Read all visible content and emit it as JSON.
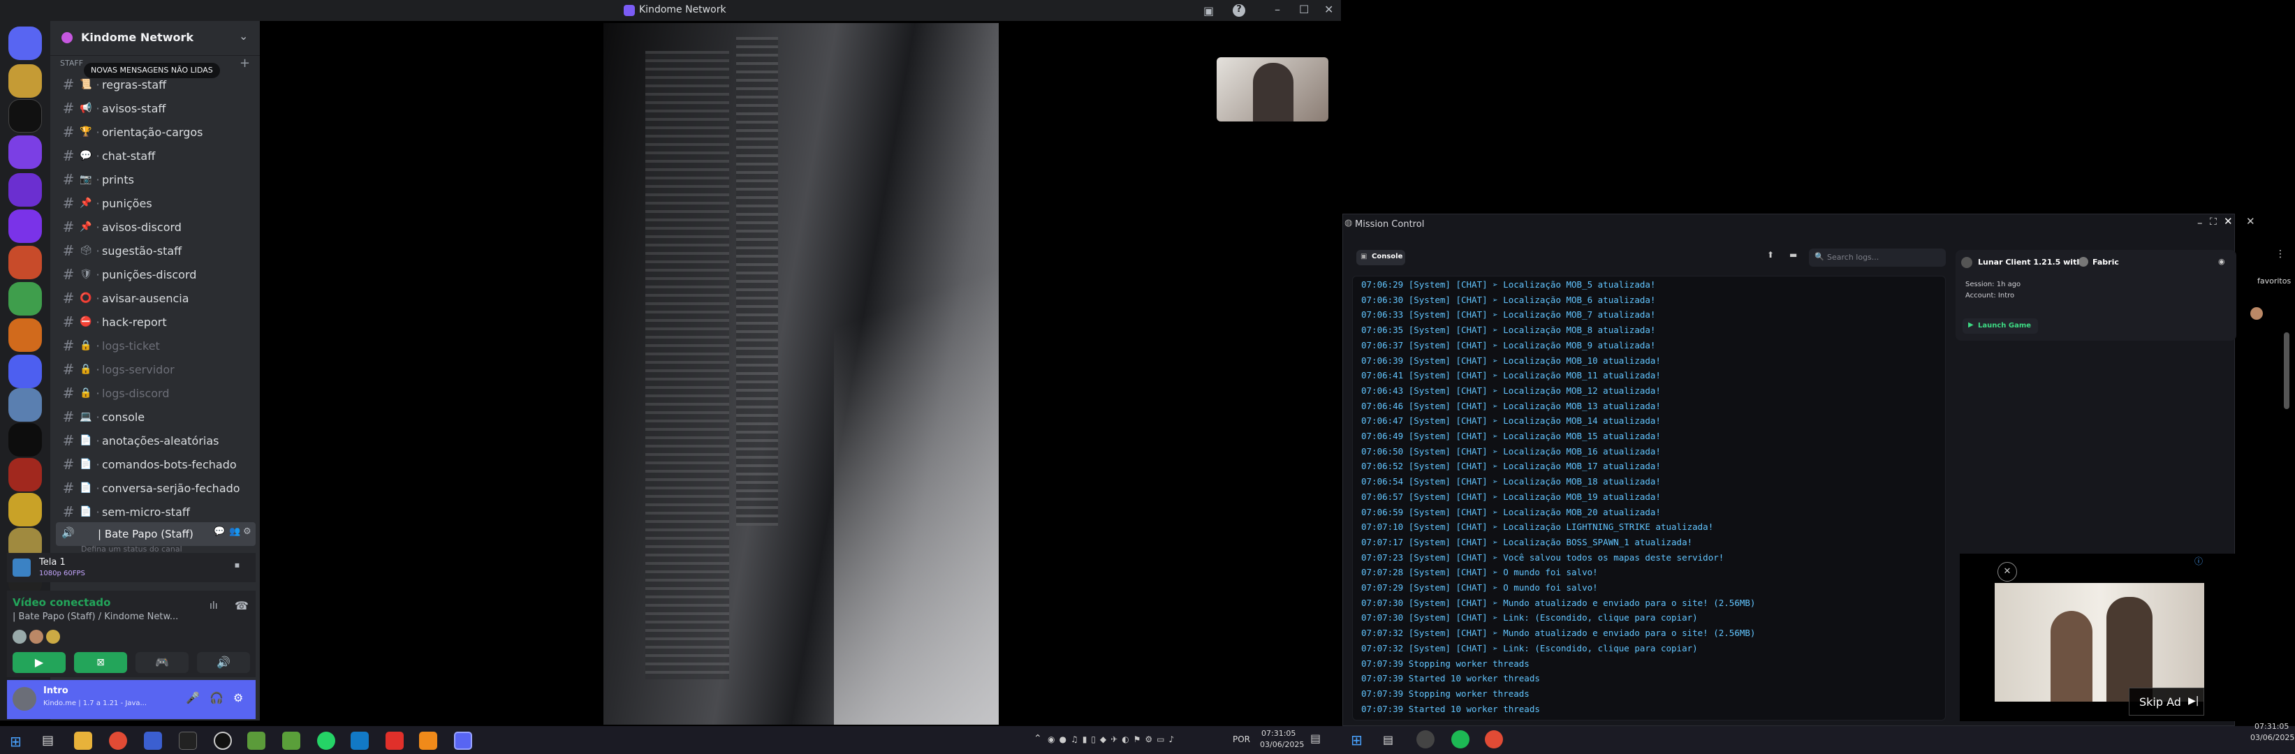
{
  "window_title": "Kindome Network",
  "server": {
    "name": "Kindome Network",
    "unread_banner": "NOVAS MENSAGENS NÃO LIDAS",
    "category_label": "STAFF"
  },
  "channels": [
    {
      "name": "regras-staff",
      "emoji": "📜",
      "muted": false
    },
    {
      "name": "avisos-staff",
      "emoji": "📢",
      "muted": false
    },
    {
      "name": "orientação-cargos",
      "emoji": "🏆",
      "muted": false
    },
    {
      "name": "chat-staff",
      "emoji": "💬",
      "muted": false
    },
    {
      "name": "prints",
      "emoji": "📷",
      "muted": false
    },
    {
      "name": "punições",
      "emoji": "📌",
      "muted": false
    },
    {
      "name": "avisos-discord",
      "emoji": "📌",
      "muted": false
    },
    {
      "name": "sugestão-staff",
      "emoji": "🗳",
      "muted": false
    },
    {
      "name": "punições-discord",
      "emoji": "🛡",
      "muted": false
    },
    {
      "name": "avisar-ausencia",
      "emoji": "⭕",
      "muted": false
    },
    {
      "name": "hack-report",
      "emoji": "⛔",
      "muted": false
    },
    {
      "name": "logs-ticket",
      "emoji": "🔒",
      "muted": true
    },
    {
      "name": "logs-servidor",
      "emoji": "🔒",
      "muted": true
    },
    {
      "name": "logs-discord",
      "emoji": "🔒",
      "muted": true
    },
    {
      "name": "console",
      "emoji": "💻",
      "muted": false
    },
    {
      "name": "anotações-aleatórias",
      "emoji": "📄",
      "muted": false
    },
    {
      "name": "comandos-bots-fechado",
      "emoji": "📄",
      "muted": false
    },
    {
      "name": "conversa-serjão-fechado",
      "emoji": "📄",
      "muted": false
    },
    {
      "name": "sem-micro-staff",
      "emoji": "📄",
      "muted": false
    }
  ],
  "voice_channel": {
    "name": "| Bate Papo (Staff)",
    "status_placeholder": "Defina um status do canal"
  },
  "stream": {
    "title": "Tela 1",
    "quality": "1080p 60FPS"
  },
  "voice_status": {
    "label": "Vídeo conectado",
    "location": "| Bate Papo (Staff) / Kindome Netw..."
  },
  "user": {
    "name": "Intro",
    "status": "Kindo.me | 1.7 a 1.21 - Java..."
  },
  "mission_control": {
    "title": "Mission Control",
    "tab": "Console",
    "search_placeholder": "Search logs...",
    "client": "Lunar Client 1.21.5 with",
    "loader": "Fabric",
    "session": "Session: 1h ago",
    "account": "Account: Intro",
    "launch": "Launch Game",
    "skip_ad": "Skip Ad",
    "favorites": "favoritos"
  },
  "logs": [
    "07:06:29 [System] [CHAT] ➢ Localização MOB_5 atualizada!",
    "07:06:30 [System] [CHAT] ➢ Localização MOB_6 atualizada!",
    "07:06:33 [System] [CHAT] ➢ Localização MOB_7 atualizada!",
    "07:06:35 [System] [CHAT] ➢ Localização MOB_8 atualizada!",
    "07:06:37 [System] [CHAT] ➢ Localização MOB_9 atualizada!",
    "07:06:39 [System] [CHAT] ➢ Localização MOB_10 atualizada!",
    "07:06:41 [System] [CHAT] ➢ Localização MOB_11 atualizada!",
    "07:06:43 [System] [CHAT] ➢ Localização MOB_12 atualizada!",
    "07:06:46 [System] [CHAT] ➢ Localização MOB_13 atualizada!",
    "07:06:47 [System] [CHAT] ➢ Localização MOB_14 atualizada!",
    "07:06:49 [System] [CHAT] ➢ Localização MOB_15 atualizada!",
    "07:06:50 [System] [CHAT] ➢ Localização MOB_16 atualizada!",
    "07:06:52 [System] [CHAT] ➢ Localização MOB_17 atualizada!",
    "07:06:54 [System] [CHAT] ➢ Localização MOB_18 atualizada!",
    "07:06:57 [System] [CHAT] ➢ Localização MOB_19 atualizada!",
    "07:06:59 [System] [CHAT] ➢ Localização MOB_20 atualizada!",
    "07:07:10 [System] [CHAT] ➢ Localização LIGHTNING_STRIKE atualizada!",
    "07:07:17 [System] [CHAT] ➢ Localização BOSS_SPAWN_1 atualizada!",
    "07:07:23 [System] [CHAT] ➢ Você salvou todos os mapas deste servidor!",
    "07:07:28 [System] [CHAT] ➢ O mundo foi salvo!",
    "07:07:29 [System] [CHAT] ➢ O mundo foi salvo!",
    "07:07:30 [System] [CHAT] ➢ Mundo atualizado e enviado para o site! (2.56MB)",
    "07:07:30 [System] [CHAT] ➢ Link: (Escondido, clique para copiar)",
    "07:07:32 [System] [CHAT] ➢ Mundo atualizado e enviado para o site! (2.56MB)",
    "07:07:32 [System] [CHAT] ➢ Link: (Escondido, clique para copiar)",
    "07:07:39 Stopping worker threads",
    "07:07:39 Started 10 worker threads",
    "07:07:39 Stopping worker threads",
    "07:07:39 Started 10 worker threads"
  ],
  "taskbar1": {
    "lang": "POR",
    "time": "07:31:05",
    "date": "03/06/2025"
  },
  "taskbar2": {
    "time": "07:31:05",
    "date": "03/06/2025"
  },
  "colors": {
    "discord_bg": "#2b2d31",
    "accent": "#5865f2",
    "green": "#23a55a",
    "log_text": "#62c5ff"
  }
}
